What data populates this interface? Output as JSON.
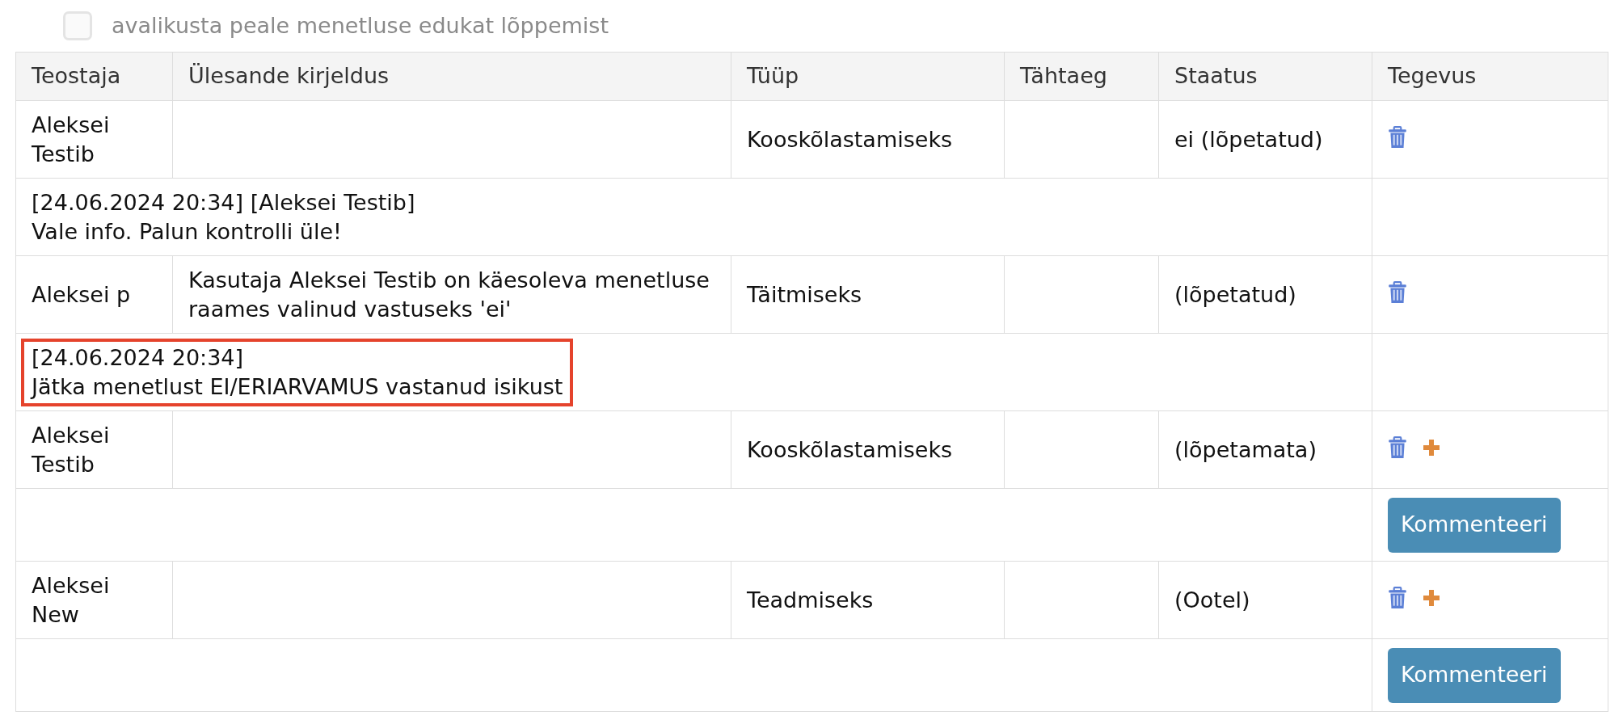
{
  "publish_option": {
    "label": "avalikusta peale menetluse edukat lõppemist",
    "checked": false,
    "disabled": true
  },
  "table": {
    "columns": [
      "Teostaja",
      "Ülesande kirjeldus",
      "Tüüp",
      "Tähtaeg",
      "Staatus",
      "Tegevus"
    ],
    "rows": [
      {
        "kind": "task",
        "performer": "Aleksei Testib",
        "description": "",
        "type": "Kooskõlastamiseks",
        "deadline": "",
        "status": "ei (lõpetatud)",
        "actions": [
          {
            "kind": "delete"
          }
        ]
      },
      {
        "kind": "comment",
        "lines": [
          "[24.06.2024 20:34] [Aleksei Testib]",
          "Vale info. Palun kontrolli üle!"
        ],
        "highlighted": false
      },
      {
        "kind": "task",
        "performer": "Aleksei p",
        "description": "Kasutaja Aleksei Testib on käesoleva menetluse raames valinud vastuseks 'ei'",
        "type": "Täitmiseks",
        "deadline": "",
        "status": "(lõpetatud)",
        "actions": [
          {
            "kind": "delete"
          }
        ]
      },
      {
        "kind": "comment",
        "lines": [
          "[24.06.2024 20:34]",
          "Jätka menetlust EI/ERIARVAMUS vastanud isikust"
        ],
        "highlighted": true
      },
      {
        "kind": "task",
        "performer": "Aleksei Testib",
        "description": "",
        "type": "Kooskõlastamiseks",
        "deadline": "",
        "status": "(lõpetamata)",
        "actions": [
          {
            "kind": "delete"
          },
          {
            "kind": "add"
          }
        ]
      },
      {
        "kind": "comment",
        "lines": [],
        "highlighted": false,
        "button": "Kommenteeri"
      },
      {
        "kind": "task",
        "performer": "Aleksei New",
        "description": "",
        "type": "Teadmiseks",
        "deadline": "",
        "status": "(Ootel)",
        "actions": [
          {
            "kind": "delete"
          },
          {
            "kind": "add"
          }
        ]
      },
      {
        "kind": "comment",
        "lines": [],
        "highlighted": false,
        "button": "Kommenteeri"
      }
    ]
  }
}
